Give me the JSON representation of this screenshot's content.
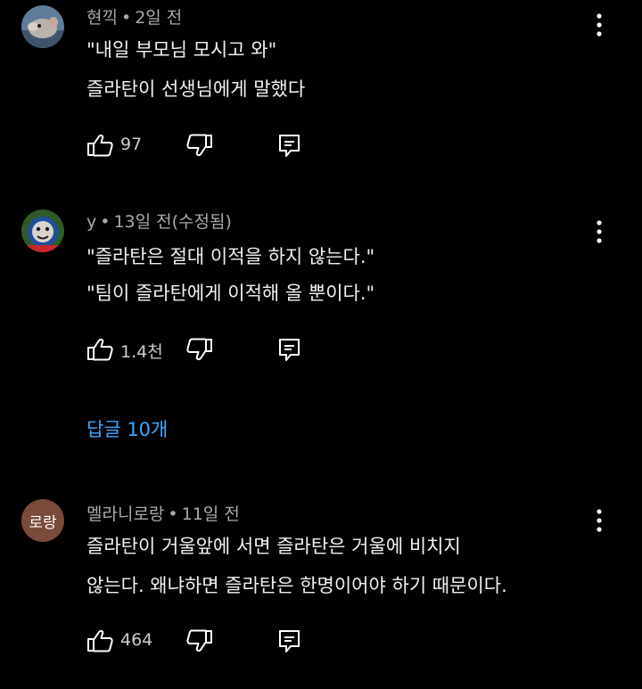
{
  "comments": [
    {
      "author": "현끽",
      "time": "2일 전",
      "lines": [
        "\"내일 부모님 모시고 와\"",
        "즐라탄이 선생님에게 말했다"
      ],
      "likes": "97",
      "avatar_icon": "rat-photo"
    },
    {
      "author": "y",
      "time": "13일 전(수정됨)",
      "lines": [
        "\"즐라탄은 절대 이적을 하지 않는다.\"",
        "\"팀이 즐라탄에게 이적해 올 뿐이다.\""
      ],
      "likes": "1.4천",
      "avatar_icon": "train-photo"
    },
    {
      "author": "멜라니로랑",
      "time": "11일 전",
      "lines": [
        "즐라탄이 거울앞에 서면 즐라탄은 거울에 비치지",
        "않는다. 왜냐하면 즐라탄은 한명이어야 하기 때문이다."
      ],
      "likes": "464",
      "avatar_text": "로랑"
    }
  ],
  "replies_label": "답글 10개",
  "icons": {
    "like": "thumbs-up-icon",
    "dislike": "thumbs-down-icon",
    "reply": "reply-icon",
    "menu": "more-vertical-icon"
  },
  "colors": {
    "background": "#000000",
    "text": "#f1f1f1",
    "meta": "#aaaaaa",
    "link": "#3ea6ff",
    "avatar_bg": "#7a4a3a"
  }
}
